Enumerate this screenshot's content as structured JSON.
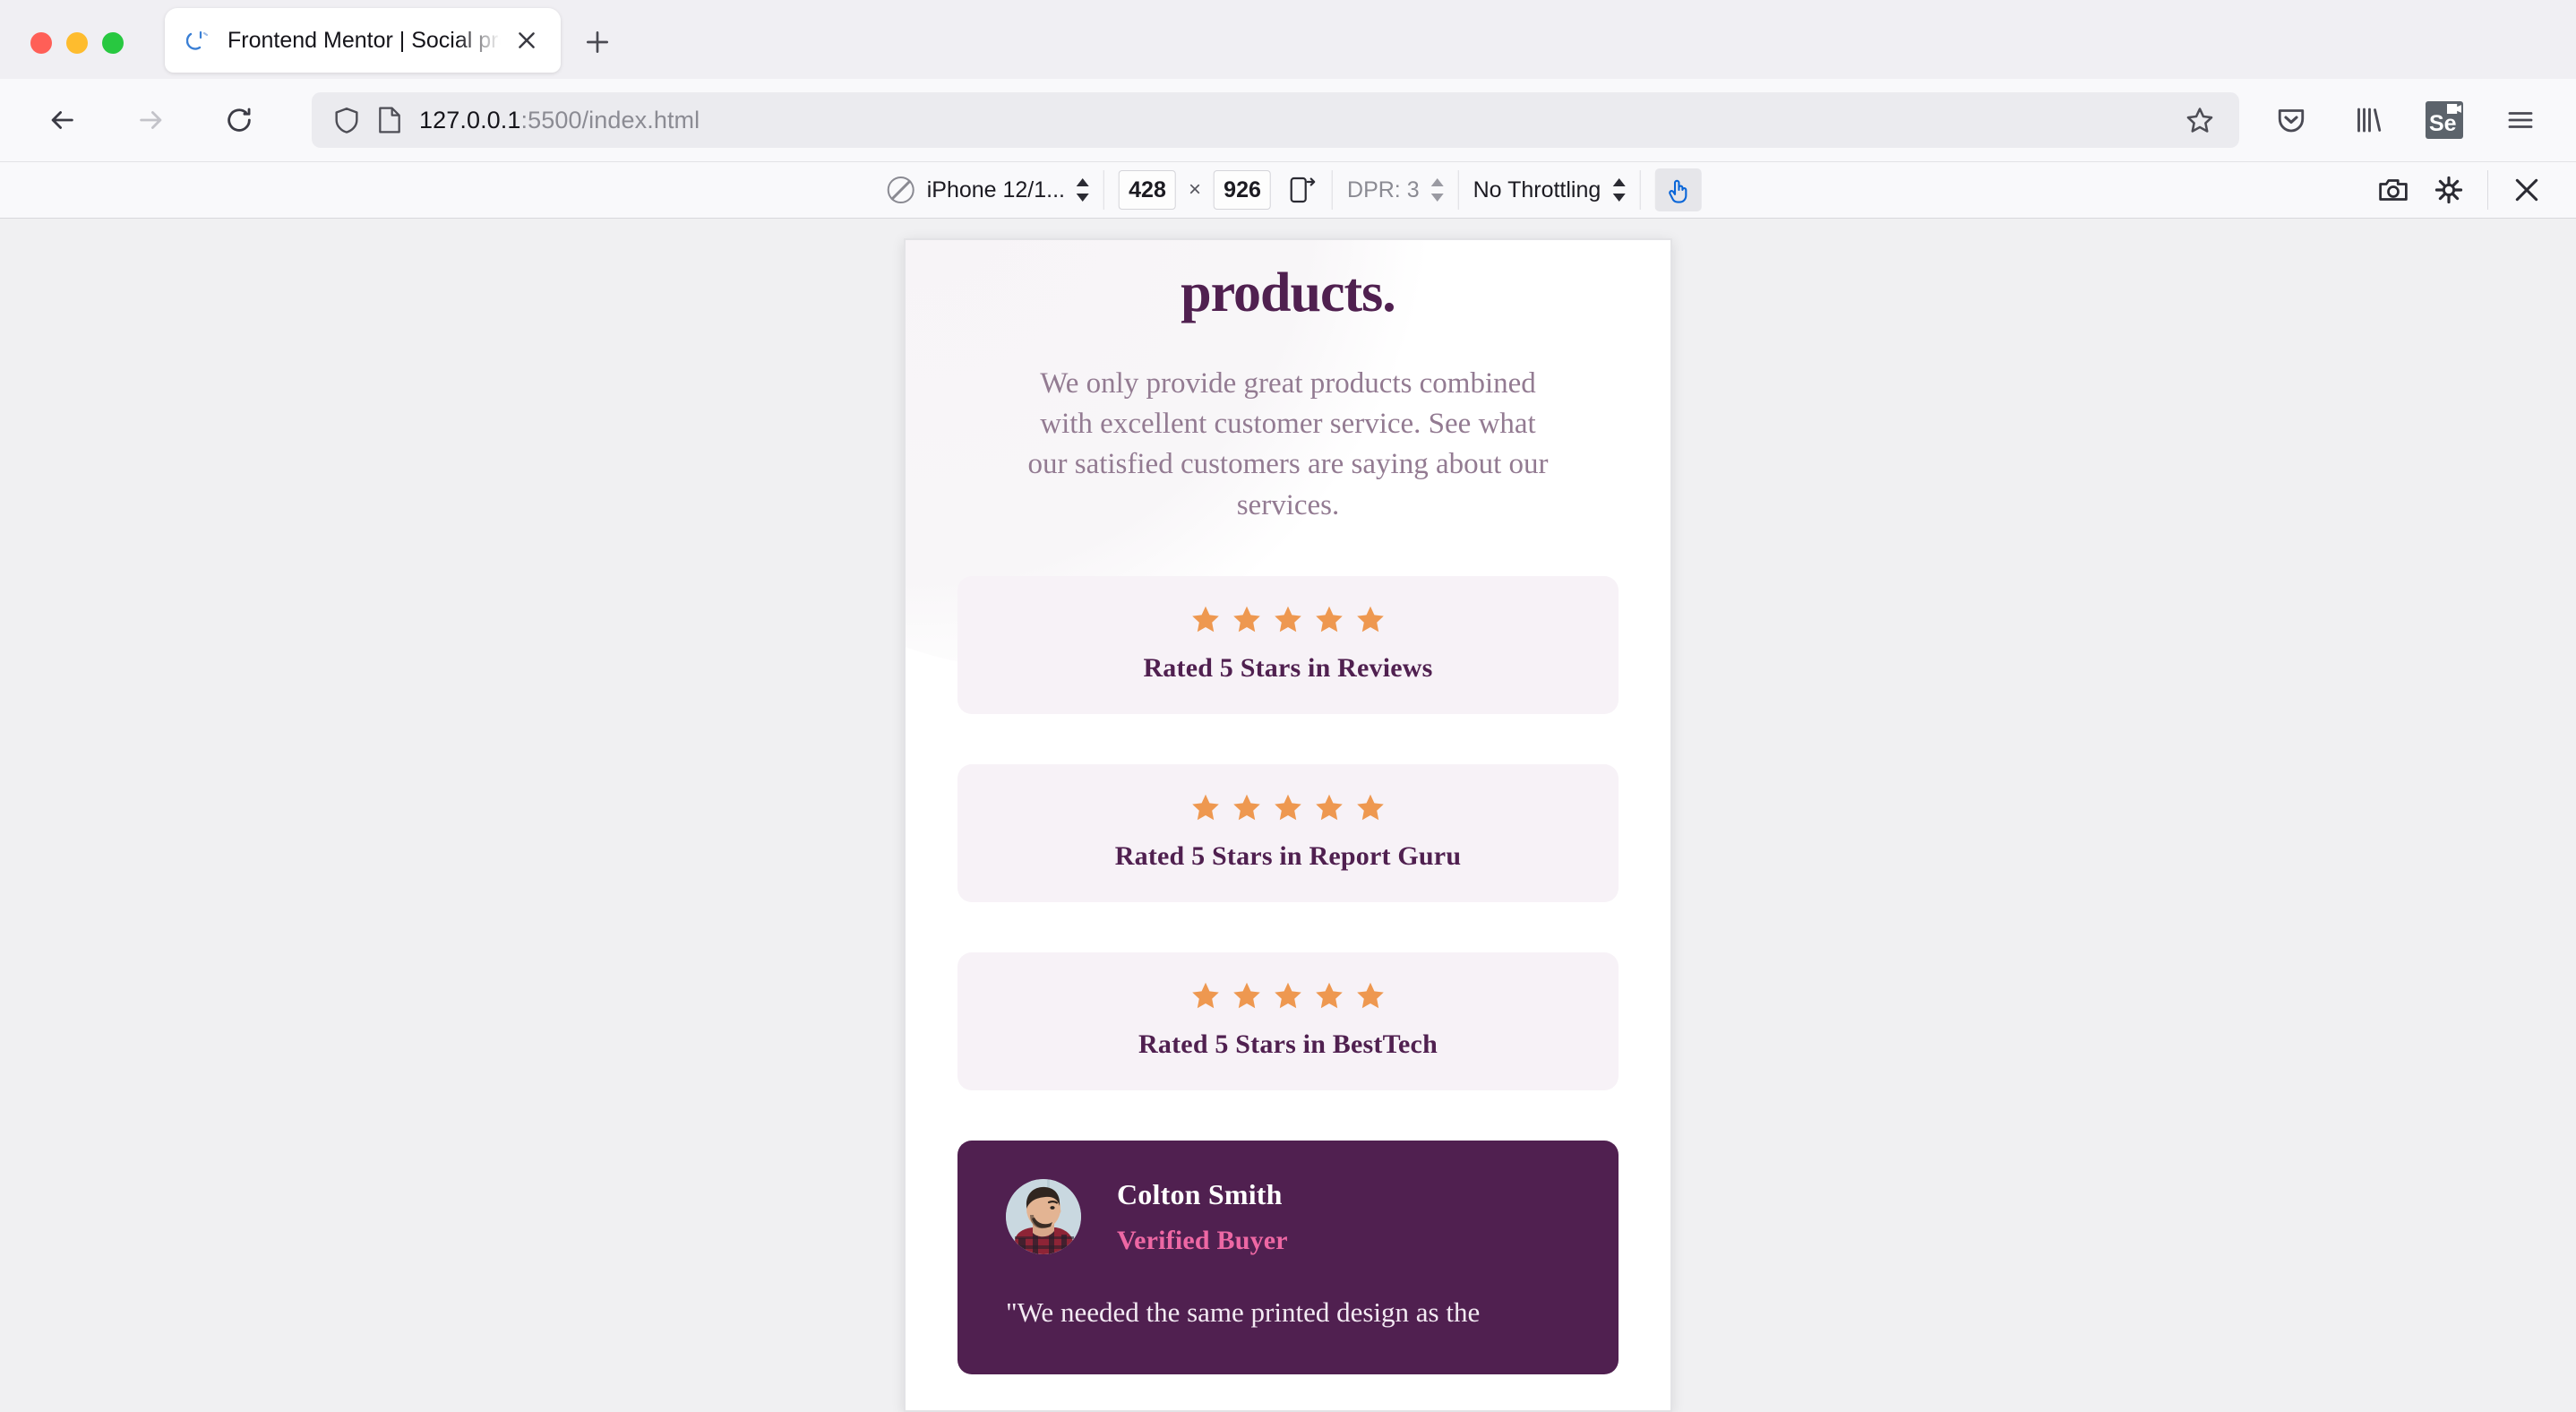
{
  "browser": {
    "window_controls": [
      "close",
      "minimize",
      "maximize"
    ],
    "tab": {
      "title": "Frontend Mentor | Social proof s",
      "favicon": "loading-spinner-icon",
      "close_label": "×"
    },
    "new_tab_label": "+",
    "nav": {
      "back": "←",
      "forward": "→",
      "reload": "⟳"
    },
    "url": {
      "host": "127.0.0.1",
      "path": ":5500/index.html",
      "full": "127.0.0.1:5500/index.html",
      "shield_icon": "shield-icon",
      "page_icon": "page-icon",
      "bookmark_icon": "star-icon"
    },
    "toolbar_icons": [
      {
        "name": "pocket-icon",
        "label": "Save to Pocket"
      },
      {
        "name": "library-icon",
        "label": "Library"
      },
      {
        "name": "selenium-extension-icon",
        "label": "Se"
      },
      {
        "name": "hamburger-menu-icon",
        "label": "Open menu"
      }
    ]
  },
  "responsive_mode": {
    "device": "iPhone 12/1...",
    "width": "428",
    "height": "926",
    "dimension_separator": "×",
    "dpr_label": "DPR: 3",
    "throttling": "No Throttling",
    "touch_simulation_active": true,
    "rotate_icon": "rotate-device-icon",
    "screenshot_icon": "camera-icon",
    "settings_icon": "gear-icon",
    "close_icon": "close-icon"
  },
  "page": {
    "title": "products.",
    "intro": "We only provide great products combined with excellent customer service. See what our satisfied customers are saying about our services.",
    "ratings": [
      {
        "stars": 5,
        "label": "Rated 5 Stars in Reviews"
      },
      {
        "stars": 5,
        "label": "Rated 5 Stars in Report Guru"
      },
      {
        "stars": 5,
        "label": "Rated 5 Stars in BestTech"
      }
    ],
    "testimonials": [
      {
        "name": "Colton Smith",
        "status": "Verified Buyer",
        "quote": "\"We needed the same printed design as the"
      }
    ],
    "colors": {
      "heading": "#502050",
      "body_text": "#937b92",
      "rating_card_bg": "#f7f2f7",
      "star": "#ee9850",
      "testimonial_bg": "#502050",
      "verified_buyer": "#ee68a4"
    }
  }
}
